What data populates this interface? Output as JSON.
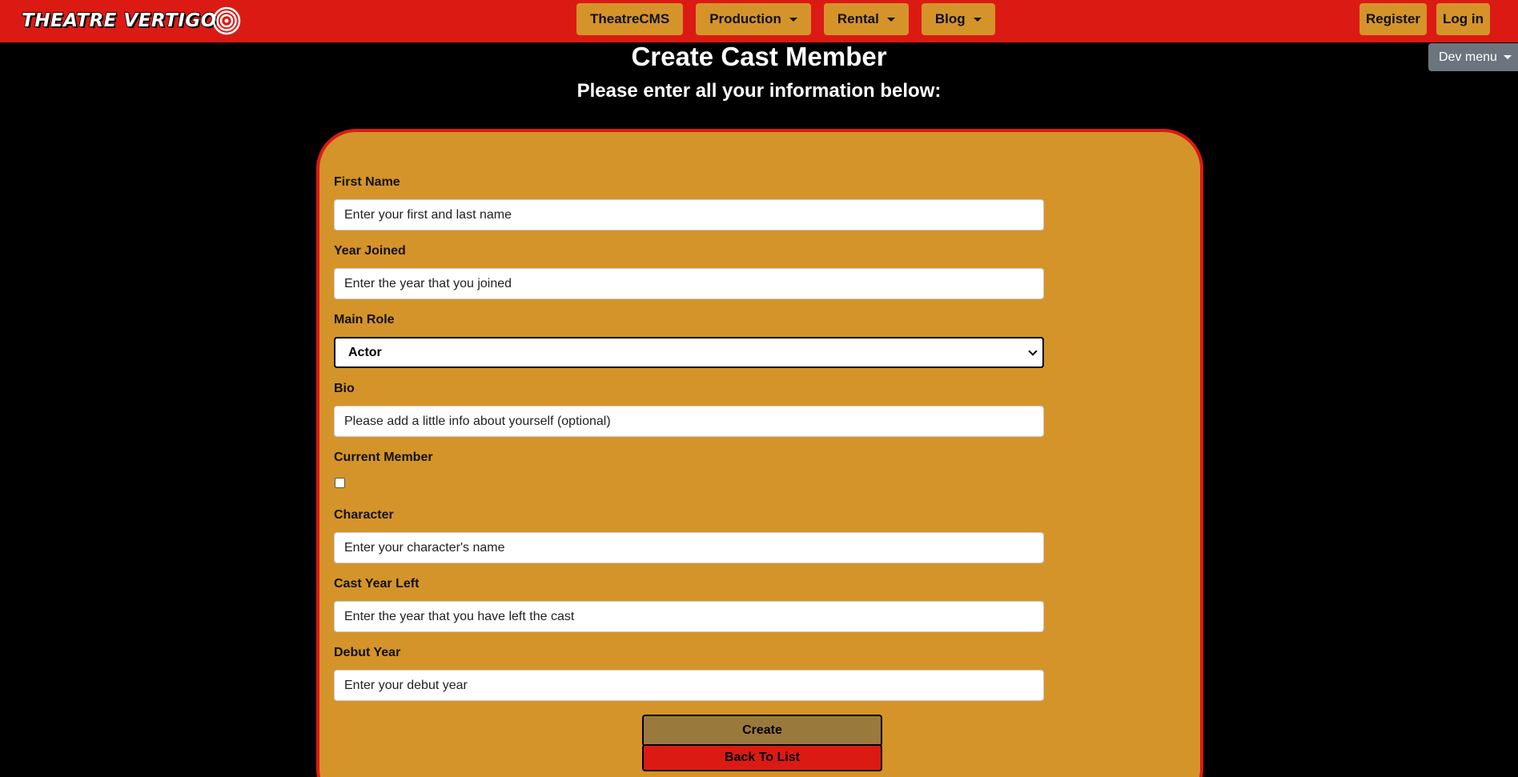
{
  "navbar": {
    "brand": "THEATRE VERTIGO",
    "items": [
      {
        "label": "TheatreCMS",
        "dropdown": false
      },
      {
        "label": "Production",
        "dropdown": true
      },
      {
        "label": "Rental",
        "dropdown": true
      },
      {
        "label": "Blog",
        "dropdown": true
      }
    ],
    "register": "Register",
    "login": "Log in"
  },
  "dev_menu": "Dev menu",
  "page": {
    "title": "Create Cast Member",
    "subtitle": "Please enter all your information below:"
  },
  "form": {
    "first_name": {
      "label": "First Name",
      "placeholder": "Enter your first and last name"
    },
    "year_joined": {
      "label": "Year Joined",
      "placeholder": "Enter the year that you joined"
    },
    "main_role": {
      "label": "Main Role",
      "value": "Actor"
    },
    "bio": {
      "label": "Bio",
      "placeholder": "Please add a little info about yourself (optional)"
    },
    "current_member": {
      "label": "Current Member",
      "checked": false
    },
    "character": {
      "label": "Character",
      "placeholder": "Enter your character's name"
    },
    "cast_year_left": {
      "label": "Cast Year Left",
      "placeholder": "Enter the year that you have left the cast"
    },
    "debut_year": {
      "label": "Debut Year",
      "placeholder": "Enter your debut year"
    },
    "create_label": "Create",
    "back_label": "Back To List"
  },
  "colors": {
    "navbar": "#dc1a14",
    "accent": "#d4942a",
    "create_button": "#9a7a3c",
    "back_button": "#dc1a14",
    "dev_menu": "#6c757d"
  }
}
